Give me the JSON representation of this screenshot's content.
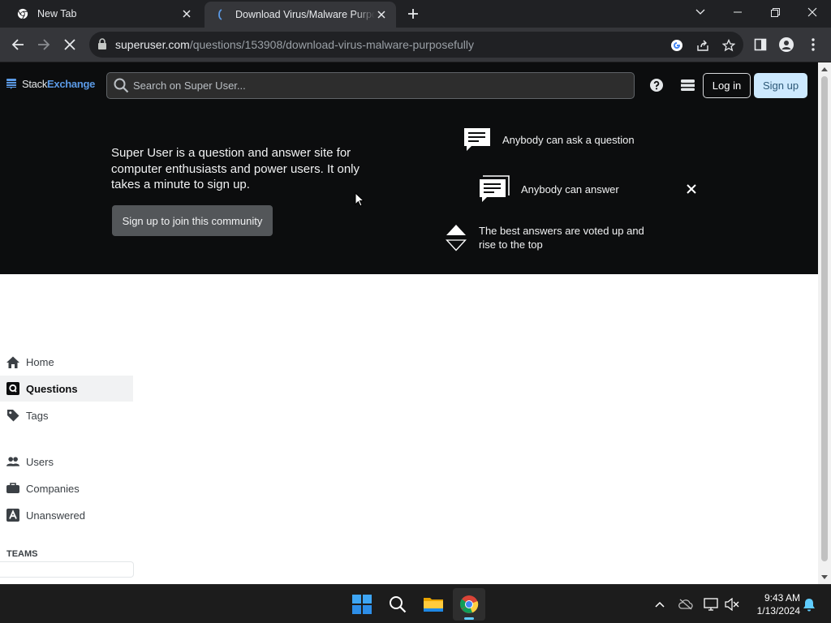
{
  "browser": {
    "tabs": [
      {
        "title": "New Tab",
        "favicon": "chrome-icon",
        "active": false
      },
      {
        "title": "Download Virus/Malware Purposefully",
        "favicon": "stackexchange-icon",
        "active": true
      }
    ],
    "url_host": "superuser.com",
    "url_path": "/questions/153908/download-virus-malware-purposefully",
    "colors": {
      "tabstrip": "#202124",
      "toolbar": "#35363a",
      "omnibox": "#202124"
    }
  },
  "site": {
    "logo_stack": "Stack",
    "logo_exchange": "Exchange",
    "search_placeholder": "Search on Super User...",
    "login_label": "Log in",
    "signup_label": "Sign up",
    "colors": {
      "topbar": "#0c0d0e",
      "signup_bg": "#cde9fe",
      "link_blue": "#5b9ae6"
    }
  },
  "hero": {
    "description": "Super User is a question and answer site for computer enthusiasts and power users. It only takes a minute to sign up.",
    "cta_label": "Sign up to join this community",
    "items": [
      {
        "icon": "speech-bubble-icon",
        "text": "Anybody can ask a question"
      },
      {
        "icon": "speech-bubbles-icon",
        "text": "Anybody can answer"
      },
      {
        "icon": "vote-arrows-icon",
        "text": "The best answers are voted up and rise to the top"
      }
    ]
  },
  "nav": {
    "items": [
      {
        "label": "Home",
        "icon": "home-icon",
        "active": false
      },
      {
        "label": "Questions",
        "icon": "questions-icon",
        "active": true
      },
      {
        "label": "Tags",
        "icon": "tag-icon",
        "active": false
      },
      {
        "label": "Users",
        "icon": "users-icon",
        "active": false
      },
      {
        "label": "Companies",
        "icon": "briefcase-icon",
        "active": false
      },
      {
        "label": "Unanswered",
        "icon": "unanswered-icon",
        "active": false
      }
    ],
    "teams_label": "TEAMS"
  },
  "taskbar": {
    "apps": [
      "windows-start-icon",
      "search-icon",
      "file-explorer-icon",
      "chrome-icon"
    ],
    "time": "9:43 AM",
    "date": "1/13/2024"
  }
}
